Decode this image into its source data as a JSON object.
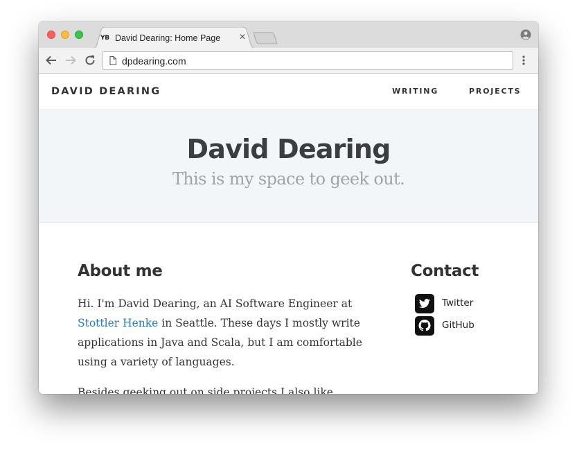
{
  "browser": {
    "tab": {
      "favicon_text": "YB",
      "title": "David Dearing: Home Page",
      "close_glyph": "×"
    },
    "address_bar": {
      "url": "dpdearing.com"
    },
    "icons": [
      "back-icon",
      "forward-icon",
      "reload-icon",
      "page-icon",
      "menu-icon",
      "profile-icon",
      "new-tab-icon"
    ]
  },
  "site": {
    "logo": "DAVID DEARING",
    "nav": [
      "WRITING",
      "PROJECTS"
    ],
    "hero": {
      "title": "David Dearing",
      "subtitle": "This is my space to geek out."
    },
    "about": {
      "heading": "About me",
      "intro_before_link": "Hi. I'm David Dearing, an AI Software Engineer at ",
      "company_link": "Stottler Henke",
      "intro_after_link": " in Seattle. These days I mostly write applications in Java and Scala, but I am comfortable using a variety of languages.",
      "second_paragraph": "Besides geeking out on side projects I also like"
    },
    "contact": {
      "heading": "Contact",
      "links": [
        {
          "label": "Twitter",
          "icon": "twitter-icon"
        },
        {
          "label": "GitHub",
          "icon": "github-icon"
        }
      ]
    },
    "colors": {
      "link": "#2a7ab5",
      "hero_bg": "#f3f6f8",
      "text": "#333333",
      "subtitle": "#a0a4a8"
    }
  }
}
